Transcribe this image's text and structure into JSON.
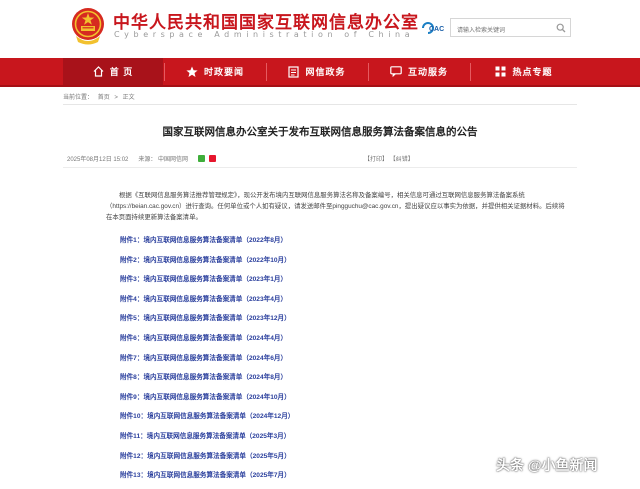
{
  "header": {
    "title": "中华人民共和国国家互联网信息办公室",
    "subtitle": "Cyberspace Administration of China",
    "logo_text": "CAC",
    "search_placeholder": "请输入检索关键词"
  },
  "nav": {
    "items": [
      {
        "label": "首 页",
        "icon": "home-icon"
      },
      {
        "label": "时政要闻",
        "icon": "star-icon"
      },
      {
        "label": "网信政务",
        "icon": "document-icon"
      },
      {
        "label": "互动服务",
        "icon": "chat-icon"
      },
      {
        "label": "热点专题",
        "icon": "grid-icon"
      }
    ],
    "active_index": 0
  },
  "breadcrumb": [
    "当前位置：",
    "首页",
    ">",
    "正文"
  ],
  "article": {
    "title": "国家互联网信息办公室关于发布互联网信息服务算法备案信息的公告",
    "date": "2025年08月12日 15:02",
    "source": "来源：  中国网信网",
    "print_label": "【打印】",
    "error_label": "【纠错】",
    "body": "根据《互联网信息服务算法推荐管理规定》，现公开发布境内互联网信息服务算法名称及备案编号，相关信息可通过互联网信息服务算法备案系统（https://beian.cac.gov.cn）进行查询。任何单位或个人如有疑议，请发送邮件至pingguchu@cac.gov.cn，提出疑议应以事实为依据，并提供相关证据材料。后续将在本页面持续更新算法备案清单。",
    "attachments": [
      "附件1：境内互联网信息服务算法备案清单（2022年8月）",
      "附件2：境内互联网信息服务算法备案清单（2022年10月）",
      "附件3：境内互联网信息服务算法备案清单（2023年1月）",
      "附件4：境内互联网信息服务算法备案清单（2023年4月）",
      "附件5：境内互联网信息服务算法备案清单（2023年12月）",
      "附件6：境内互联网信息服务算法备案清单（2024年4月）",
      "附件7：境内互联网信息服务算法备案清单（2024年6月）",
      "附件8：境内互联网信息服务算法备案清单（2024年8月）",
      "附件9：境内互联网信息服务算法备案清单（2024年10月）",
      "附件10：境内互联网信息服务算法备案清单（2024年12月）",
      "附件11：境内互联网信息服务算法备案清单（2025年3月）",
      "附件12：境内互联网信息服务算法备案清单（2025年5月）",
      "附件13：境内互联网信息服务算法备案清单（2025年7月）"
    ]
  },
  "watermark": "头条 @小鱼新闻",
  "colors": {
    "brand_red": "#c8161d",
    "link_blue": "#2a3f9d"
  }
}
